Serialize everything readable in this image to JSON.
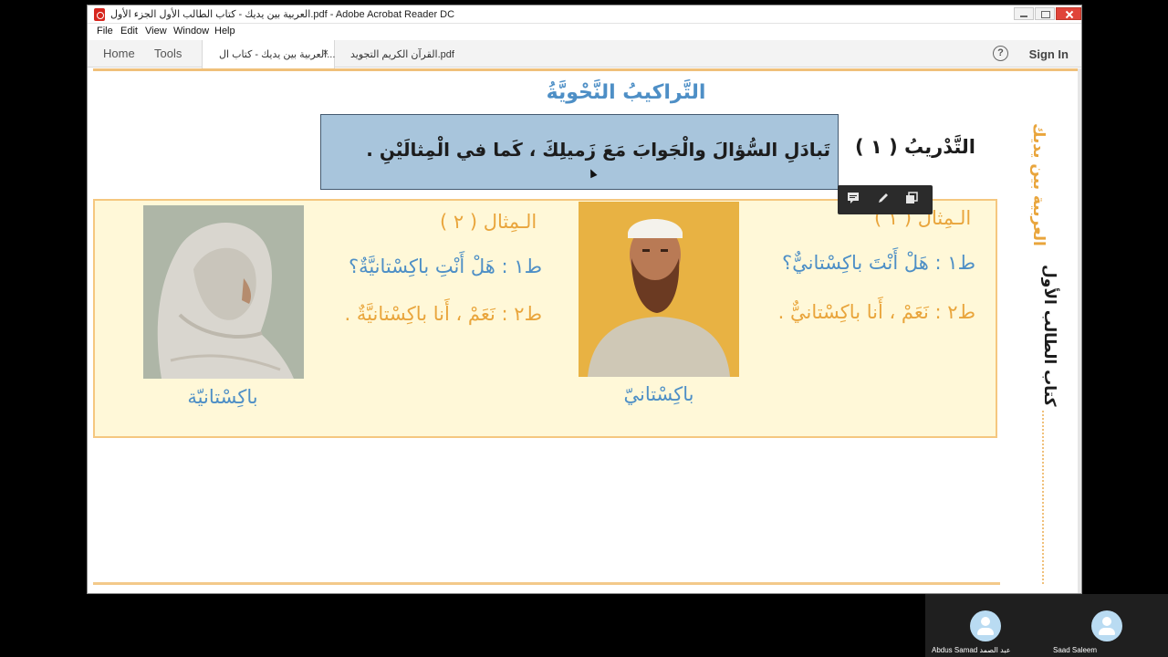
{
  "window": {
    "title": "العربية بين يديك - كتاب الطالب الأول الجزء الأول.pdf - Adobe Acrobat Reader DC"
  },
  "menu": {
    "file": "File",
    "edit": "Edit",
    "view": "View",
    "window": "Window",
    "help": "Help"
  },
  "tabs": {
    "home": "Home",
    "tools": "Tools",
    "doc1": "العربية بين يديك - كتاب ال...",
    "doc1_close": "×",
    "doc2": "القرآن الكريم التجويد.pdf"
  },
  "header_right": {
    "help": "?",
    "sign_in": "Sign In"
  },
  "page": {
    "heading": "التَّراكيبُ النَّحْويَّةُ",
    "exercise_label": "التَّدْريبُ ( ١ )",
    "instruction": "تَبادَلِ السُّؤالَ والْجَوابَ مَعَ زَميلِكَ ، كَما في الْمِثالَيْنِ .",
    "example1": {
      "title": "الـمِثال ( ١ )",
      "question": "ط١ : هَلْ أَنْتَ باكِسْتانيٌّ؟",
      "answer": "ط٢ : نَعَمْ ، أَنا باكِسْتانيٌّ .",
      "caption": "باكِسْتانيّ"
    },
    "example2": {
      "title": "الـمِثال ( ٢ )",
      "question": "ط١ : هَلْ أَنْتِ باكِسْتانيَّةٌ؟",
      "answer": "ط٢ : نَعَمْ ، أَنا باكِسْتانيَّةٌ .",
      "caption": "باكِسْتانيّة"
    },
    "side_title": "العربية بين يديك",
    "side_subtitle": "كتاب الطالب الأول"
  },
  "annotation_toolbar": {
    "comment_icon": "comment-icon",
    "pen_icon": "pen-icon",
    "copy_icon": "copy-icon"
  },
  "participants": [
    {
      "name": "Abdus Samad عبد الصمد"
    },
    {
      "name": "Saad Saleem"
    }
  ],
  "colors": {
    "heading_blue": "#4e8fc6",
    "accent_orange": "#e9a53c",
    "highlight_blue": "#a8c5dc",
    "panel_yellow": "#fff8d8"
  }
}
